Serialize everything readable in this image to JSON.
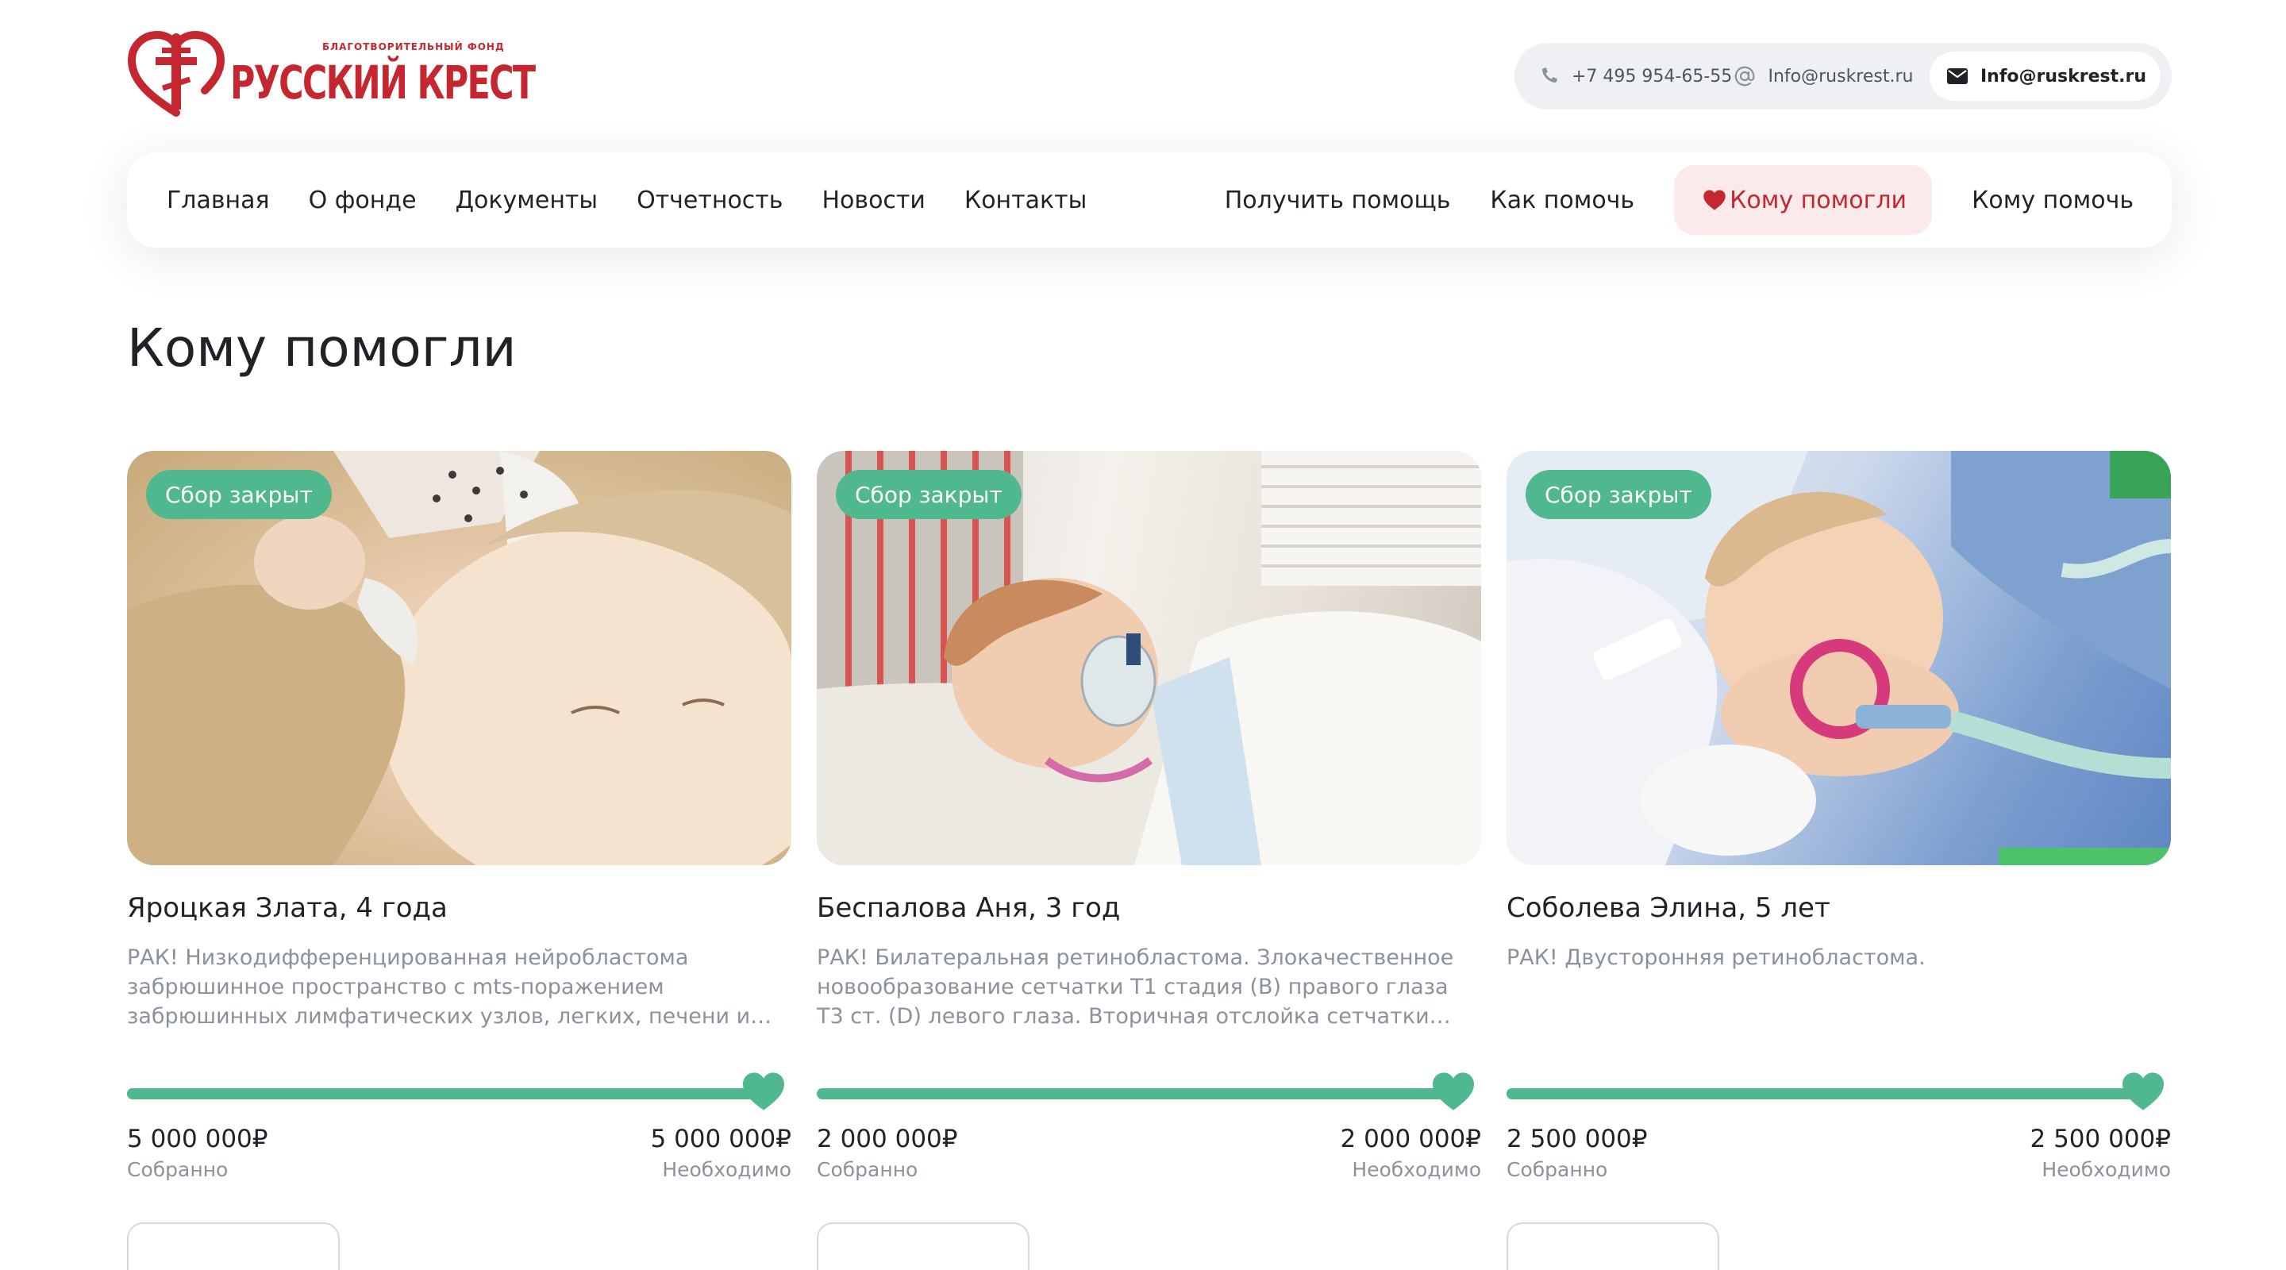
{
  "logo": {
    "subtitle": "БЛАГОТВОРИТЕЛЬНЫЙ ФОНД",
    "name": "РУССКИЙ КРЕСТ",
    "icon": "heart-cross-logo",
    "color": "#c4272f"
  },
  "contacts": {
    "phone": "+7 495 954-65-55",
    "email_1": "Info@ruskrest.ru",
    "email_2": "Info@ruskrest.ru"
  },
  "nav": {
    "left": [
      "Главная",
      "О фонде",
      "Документы",
      "Отчетность",
      "Новости",
      "Контакты"
    ],
    "right": [
      "Получить помощь",
      "Как помочь",
      "Кому помогли",
      "Кому помочь"
    ],
    "active": "Кому помогли"
  },
  "page": {
    "title": "Кому помогли"
  },
  "colors": {
    "accent": "#4fb88f",
    "brand_red": "#c4272f",
    "muted_text": "#8a929c"
  },
  "cards": [
    {
      "badge": "Сбор закрыт",
      "name": "Яроцкая Злата, 4 года",
      "description": "РАК! Низкодифференцированная нейробластома забрюшинное пространство с mts-поражением забрюшинных лимфатических узлов, легких, печени и…",
      "collected": "5 000 000₽",
      "collected_label": "Собранно",
      "needed": "5 000 000₽",
      "needed_label": "Необходимо",
      "progress": 1.0
    },
    {
      "badge": "Сбор закрыт",
      "name": "Беспалова Аня, 3 год",
      "description": "РАК! Билатеральная ретинобластома. Злокачественное новообразование сетчатки Т1 стадия (В) правого глаза Т3 ст. (D) левого глаза. Вторичная отслойка сетчатки левого…",
      "collected": "2 000 000₽",
      "collected_label": "Собранно",
      "needed": "2 000 000₽",
      "needed_label": "Необходимо",
      "progress": 1.0
    },
    {
      "badge": "Сбор закрыт",
      "name": "Соболева Элина, 5 лет",
      "description": "РАК! Двусторонняя ретинобластома.",
      "collected": "2 500 000₽",
      "collected_label": "Собранно",
      "needed": "2 500 000₽",
      "needed_label": "Необходимо",
      "progress": 1.0
    }
  ]
}
